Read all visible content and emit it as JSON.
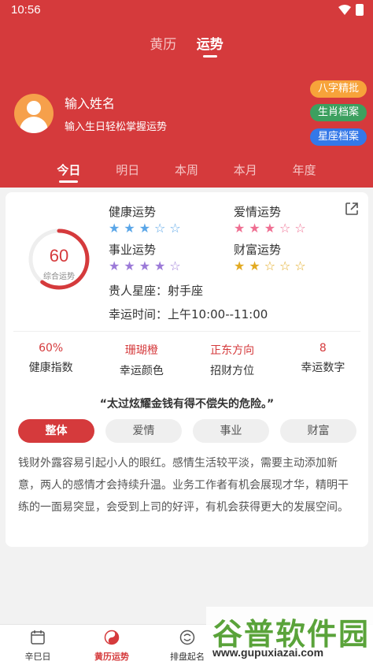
{
  "status_bar": {
    "time": "10:56"
  },
  "top_tabs": [
    {
      "label": "黄历"
    },
    {
      "label": "运势",
      "active": true
    }
  ],
  "profile": {
    "name": "输入姓名",
    "subtitle": "输入生日轻松掌握运势"
  },
  "tags": [
    {
      "label": "八字精批",
      "color": "#f7a33a"
    },
    {
      "label": "生肖档案",
      "color": "#3ca05f"
    },
    {
      "label": "星座档案",
      "color": "#3478e8"
    }
  ],
  "period_tabs": [
    {
      "label": "今日",
      "active": true
    },
    {
      "label": "明日"
    },
    {
      "label": "本周"
    },
    {
      "label": "本月"
    },
    {
      "label": "年度"
    }
  ],
  "score": {
    "value": "60",
    "label": "综合运势",
    "fraction": 0.6
  },
  "fortunes": {
    "health": {
      "label": "健康运势",
      "stars": 3,
      "max": 5,
      "color": "#5aa6e8"
    },
    "love": {
      "label": "爱情运势",
      "stars": 3,
      "max": 5,
      "color": "#ef6f92"
    },
    "career": {
      "label": "事业运势",
      "stars": 4,
      "max": 5,
      "color": "#9c7ad8"
    },
    "wealth": {
      "label": "财富运势",
      "stars": 2,
      "max": 5,
      "color": "#e2aa22"
    }
  },
  "info": {
    "noble_star": "贵人星座：射手座",
    "lucky_time": "幸运时间：上午10:00--11:00"
  },
  "stats": [
    {
      "value": "60%",
      "label": "健康指数"
    },
    {
      "value": "珊瑚橙",
      "label": "幸运颜色"
    },
    {
      "value": "正东方向",
      "label": "招财方位"
    },
    {
      "value": "8",
      "label": "幸运数字"
    }
  ],
  "quote": "“太过炫耀金钱有得不偿失的危险。”",
  "segments": [
    {
      "label": "整体",
      "active": true
    },
    {
      "label": "爱情"
    },
    {
      "label": "事业"
    },
    {
      "label": "财富"
    }
  ],
  "description": "钱财外露容易引起小人的眼红。感情生活较平淡，需要主动添加新意，两人的感情才会持续升温。业务工作者有机会展现才华，精明干练的一面易突显，会受到上司的好评，有机会获得更大的发展空间。",
  "bottom_nav": [
    {
      "label": "辛巳日",
      "icon": "calendar-icon"
    },
    {
      "label": "黄历运势",
      "icon": "yinyang-icon",
      "active": true
    },
    {
      "label": "排盘起名",
      "icon": "compass-icon"
    }
  ],
  "watermark": {
    "title": "谷普软件园",
    "url": "www.gupuxiazai.com"
  },
  "colors": {
    "brand": "#d53a3c",
    "star_empty_stroke": "#c9c9c9"
  }
}
